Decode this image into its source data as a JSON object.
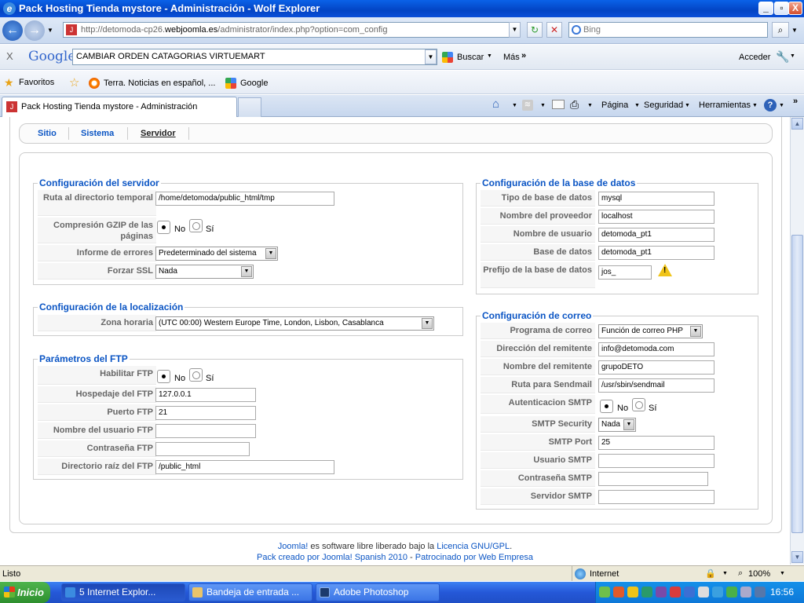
{
  "window": {
    "title": "Pack Hosting Tienda mystore - Administración - Wolf Explorer",
    "min": "_",
    "max": "▫",
    "close": "X"
  },
  "address": {
    "url_prefix": "http://detomoda-cp26.",
    "url_host": "webjoomla.es",
    "url_path": "/administrator/index.php?option=com_config",
    "search_placeholder": "Bing"
  },
  "google_toolbar": {
    "close": "X",
    "logo": "Google",
    "query": "CAMBIAR ORDEN CATAGORIAS VIRTUEMART",
    "search_label": "Buscar",
    "more": "Más",
    "login": "Acceder"
  },
  "favorites": {
    "label": "Favoritos",
    "link1": "Terra. Noticias en español, ...",
    "link2": "Google"
  },
  "tabs": {
    "active": "Pack Hosting Tienda mystore - Administración",
    "cmd_page": "Página",
    "cmd_security": "Seguridad",
    "cmd_tools": "Herramientas"
  },
  "submenu": {
    "items": [
      "Sitio",
      "Sistema",
      "Servidor"
    ]
  },
  "server_config": {
    "legend": "Configuración del servidor",
    "tmp_label": "Ruta al directorio temporal",
    "tmp_value": "/home/detomoda/public_html/tmp",
    "gzip_label": "Compresión GZIP de las páginas",
    "no": "No",
    "si": "Sí",
    "errors_label": "Informe de errores",
    "errors_value": "Predeterminado del sistema",
    "ssl_label": "Forzar SSL",
    "ssl_value": "Nada"
  },
  "locale_config": {
    "legend": "Configuración de la localización",
    "tz_label": "Zona horaria",
    "tz_value": "(UTC 00:00) Western Europe Time, London, Lisbon, Casablanca"
  },
  "ftp_config": {
    "legend": "Parámetros del FTP",
    "enable_label": "Habilitar FTP",
    "no": "No",
    "si": "Sí",
    "host_label": "Hospedaje del FTP",
    "host_value": "127.0.0.1",
    "port_label": "Puerto FTP",
    "port_value": "21",
    "user_label": "Nombre del usuario FTP",
    "user_value": "",
    "pass_label": "Contraseña FTP",
    "pass_value": "",
    "root_label": "Directorio raíz del FTP",
    "root_value": "/public_html"
  },
  "db_config": {
    "legend": "Configuración de la base de datos",
    "type_label": "Tipo de base de datos",
    "type_value": "mysql",
    "host_label": "Nombre del proveedor",
    "host_value": "localhost",
    "user_label": "Nombre de usuario",
    "user_value": "detomoda_pt1",
    "db_label": "Base de datos",
    "db_value": "detomoda_pt1",
    "prefix_label": "Prefijo de la base de datos",
    "prefix_value": "jos_",
    "warn": "!"
  },
  "mail_config": {
    "legend": "Configuración de correo",
    "mailer_label": "Programa de correo",
    "mailer_value": "Función de correo PHP",
    "from_label": "Dirección del remitente",
    "from_value": "info@detomoda.com",
    "fromname_label": "Nombre del remitente",
    "fromname_value": "grupoDETO",
    "sendmail_label": "Ruta para Sendmail",
    "sendmail_value": "/usr/sbin/sendmail",
    "smtpauth_label": "Autenticacion SMTP",
    "no": "No",
    "si": "Sí",
    "smtpsec_label": "SMTP Security",
    "smtpsec_value": "Nada",
    "smtpport_label": "SMTP Port",
    "smtpport_value": "25",
    "smtpuser_label": "Usuario SMTP",
    "smtpuser_value": "",
    "smtppass_label": "Contraseña SMTP",
    "smtppass_value": "",
    "smtphost_label": "Servidor SMTP",
    "smtphost_value": ""
  },
  "footer": {
    "joomla": "Joomla!",
    "text1": " es software libre liberado bajo la ",
    "license": "Licencia GNU/GPL",
    "dot": ".",
    "line2a": "Pack creado por Joomla! Spanish 2010",
    "dash": " - ",
    "line2b": "Patrocinado por Web Empresa"
  },
  "status": {
    "text": "Listo",
    "zone": "Internet",
    "zoom": "100%"
  },
  "taskbar": {
    "start": "Inicio",
    "t1": "5 Internet Explor...",
    "t2": "Bandeja de entrada ...",
    "t3": "Adobe Photoshop",
    "clock": "16:56"
  },
  "colors": {
    "link": "#0b55c4",
    "label": "#666666",
    "xp_blue": "#245edb"
  }
}
